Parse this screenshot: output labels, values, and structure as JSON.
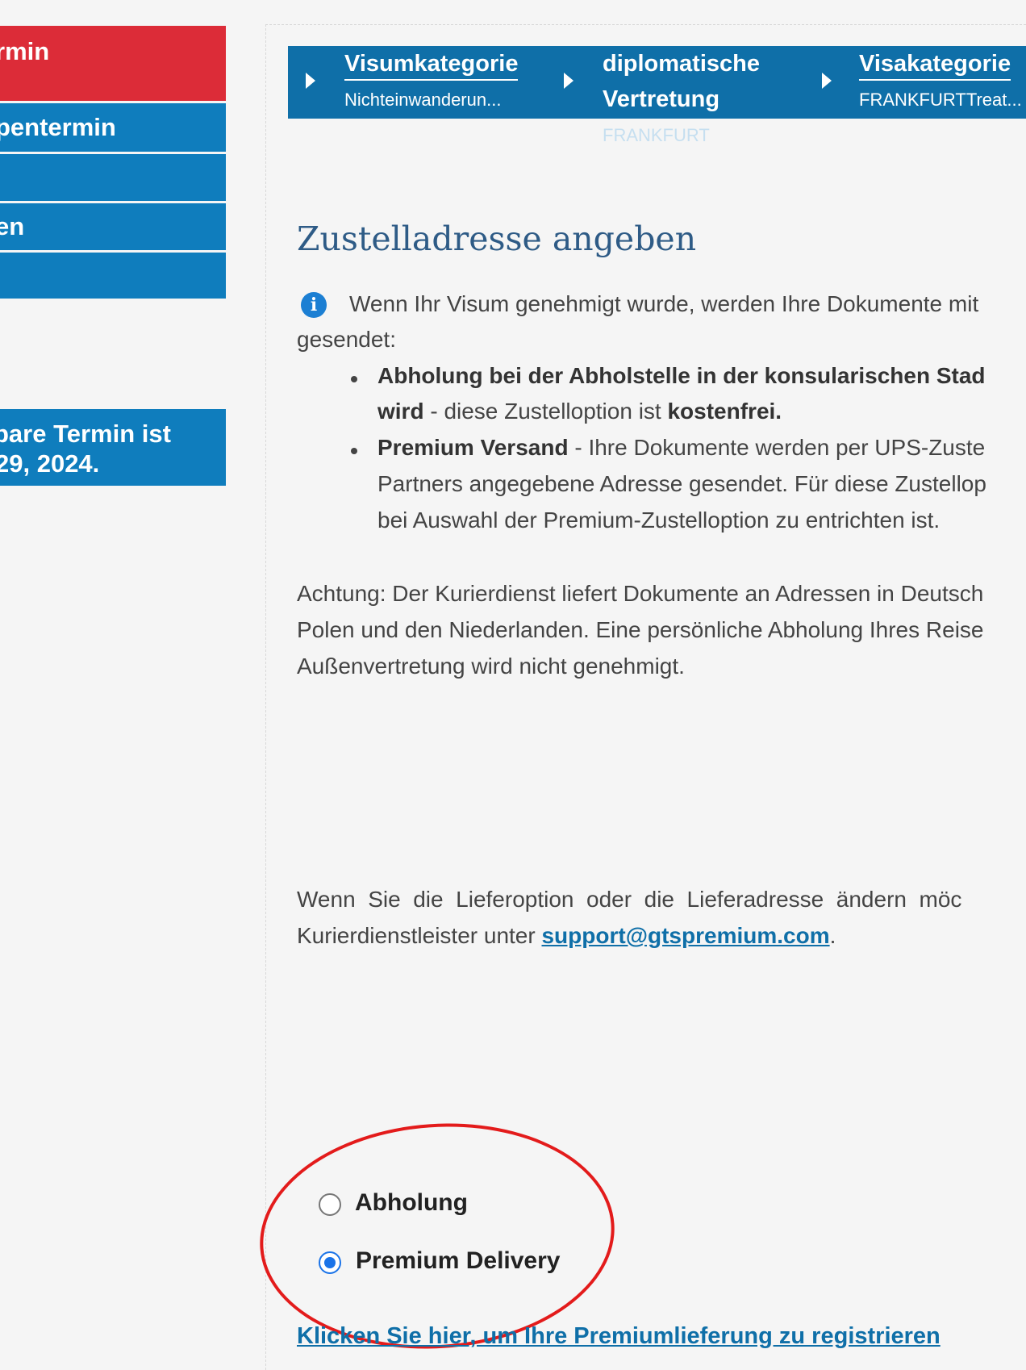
{
  "sidebar": {
    "items": [
      {
        "label": "rmin",
        "active": true
      },
      {
        "label": "pentermin",
        "active": false
      },
      {
        "label": "",
        "active": false
      },
      {
        "label": "en",
        "active": false
      },
      {
        "label": "",
        "active": false
      }
    ],
    "notice_line1": "bare Termin ist",
    "notice_line2": "29, 2024."
  },
  "breadcrumb": [
    {
      "title": "Visumkategorie",
      "sub": "Nichteinwanderun..."
    },
    {
      "title_line1": "diplomatische",
      "title_line2": "Vertretung",
      "sub": "FRANKFURT"
    },
    {
      "title": "Visakategorie",
      "sub": "FRANKFURTTreat..."
    }
  ],
  "main": {
    "heading": "Zustelladresse angeben",
    "info_line1": "Wenn Ihr Visum genehmigt wurde, werden Ihre Dokumente mit",
    "info_line2": "gesendet:",
    "bullet1": {
      "bold1": "Abholung bei der Abholstelle in der konsularischen Stad",
      "bold2": "wird",
      "text2": " - diese Zustelloption ist ",
      "bold3": "kostenfrei."
    },
    "bullet2": {
      "bold1": "Premium Versand",
      "text1": " - Ihre Dokumente werden per UPS-Zuste",
      "line2": "Partners angegebene Adresse gesendet. Für diese Zustellop",
      "line3": "bei Auswahl der Premium-Zustelloption zu entrichten ist."
    },
    "achtung_line1": "Achtung: Der Kurierdienst liefert Dokumente an Adressen in Deutsch",
    "achtung_line2": "Polen und den Niederlanden. Eine persönliche Abholung Ihres Reise",
    "achtung_line3": "Außenvertretung wird nicht genehmigt.",
    "change_line1": "Wenn  Sie  die  Lieferoption  oder  die  Lieferadresse  ändern  möc",
    "change_line2_prefix": "Kurierdienstleister unter ",
    "support_email": "support@gtspremium.com",
    "change_line2_suffix": "."
  },
  "delivery_options": [
    {
      "label": "Abholung",
      "checked": false
    },
    {
      "label": "Premium Delivery",
      "checked": true
    }
  ],
  "register_link": "Klicken Sie hier, um Ihre Premiumlieferung zu registrieren",
  "colors": {
    "sidebar_blue": "#0f7dbd",
    "sidebar_active_red": "#dc2c38",
    "breadcrumb_blue": "#0f6fa8",
    "heading_blue": "#2e5b86",
    "annotation_red": "#e31b1b",
    "radio_selected": "#1a73e8"
  }
}
